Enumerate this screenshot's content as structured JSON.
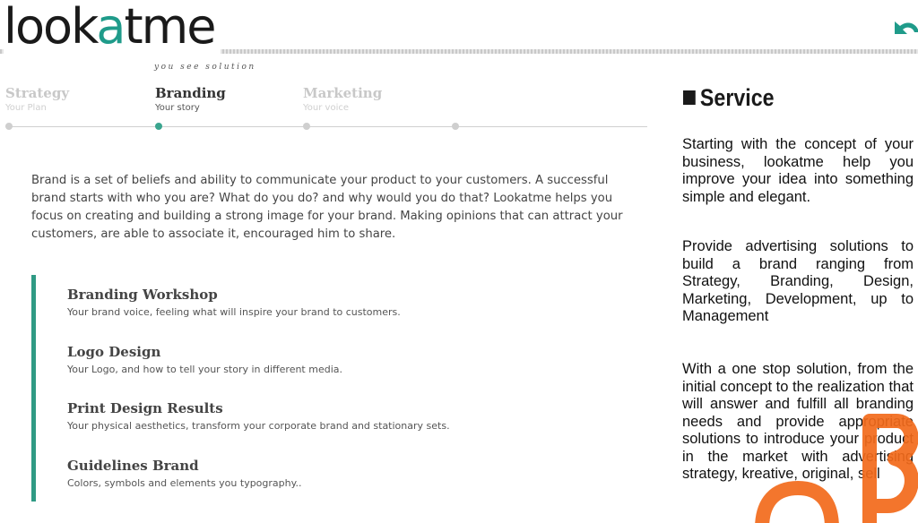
{
  "header": {
    "logo_text_part1": "look",
    "logo_text_accent": "a",
    "logo_text_part2": "tme",
    "tagline": "you see solution",
    "back_icon": "undo-arrow-icon",
    "accent_color": "#1f9b8a"
  },
  "tabs": [
    {
      "title": "Strategy",
      "subtitle": "Your Plan",
      "active": false
    },
    {
      "title": "Branding",
      "subtitle": "Your story",
      "active": true
    },
    {
      "title": "Marketing",
      "subtitle": "Your voice",
      "active": false
    }
  ],
  "main": {
    "intro": "Brand is a set of beliefs and ability to communicate your product to your customers. A successful brand starts with who you are? What do you do? and why would you do that? Lookatme helps you focus on creating and building a strong image for your brand. Making opinions that can attract your customers, are able to associate it, encouraged him to share.",
    "services": [
      {
        "title": "Branding Workshop",
        "desc": "Your brand voice, feeling what will inspire your brand to customers."
      },
      {
        "title": "Logo Design",
        "desc": "Your Logo, and how to tell your story in different media."
      },
      {
        "title": "Print Design Results",
        "desc": "Your physical aesthetics, transform your corporate brand and stationary sets."
      },
      {
        "title": "Guidelines Brand",
        "desc": "Colors, symbols and elements you typography.."
      }
    ]
  },
  "sidebar": {
    "heading": "Service",
    "paragraphs": [
      "Starting with the concept of your business, lookatme help you improve your idea into something simple and elegant.",
      "Provide advertising solutions to build a brand ranging from Strategy, Branding, Design, Marketing, Development, up to Management",
      "With a one stop solution, from the initial concept to the realization that will answer and fulfill all branding needs and provide appropriate solutions to introduce your product in the market with advertising strategy, kreative, original, sell"
    ],
    "watermark_color": "#f26a1b"
  }
}
